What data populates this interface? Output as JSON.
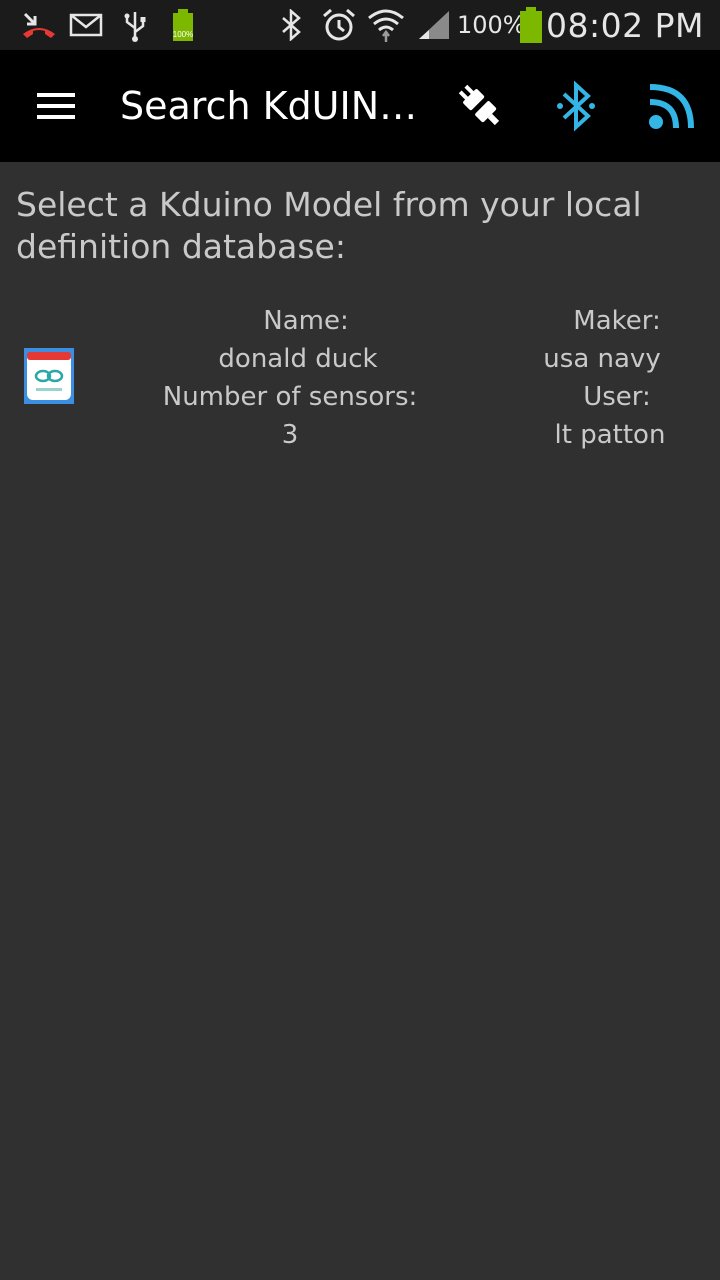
{
  "status_bar": {
    "battery_percent": "100%",
    "time": "08:02 PM",
    "icons": [
      "missed-call-icon",
      "email-icon",
      "usb-icon",
      "battery-small-icon",
      "bluetooth-icon",
      "alarm-icon",
      "wifi-icon",
      "signal-icon",
      "battery-icon"
    ]
  },
  "action_bar": {
    "title": "Search KdUIN…",
    "actions": [
      "plug-icon",
      "bluetooth-icon",
      "rss-icon"
    ]
  },
  "content": {
    "prompt": "Select a Kduino Model from your local definition database:",
    "models": [
      {
        "name_label": "Name:",
        "name": "donald duck",
        "sensors_label": "Number of sensors:",
        "sensors": "3",
        "maker_label": "Maker:",
        "maker": "usa navy",
        "user_label": "User:",
        "user": "lt patton"
      }
    ]
  },
  "colors": {
    "background": "#303030",
    "action_bar": "#000000",
    "status_bar": "#1b1b1b",
    "accent_blue": "#33b5e5",
    "battery_green": "#7cb800",
    "missed_call_red": "#e53935",
    "text_secondary": "#c9c9c9"
  }
}
